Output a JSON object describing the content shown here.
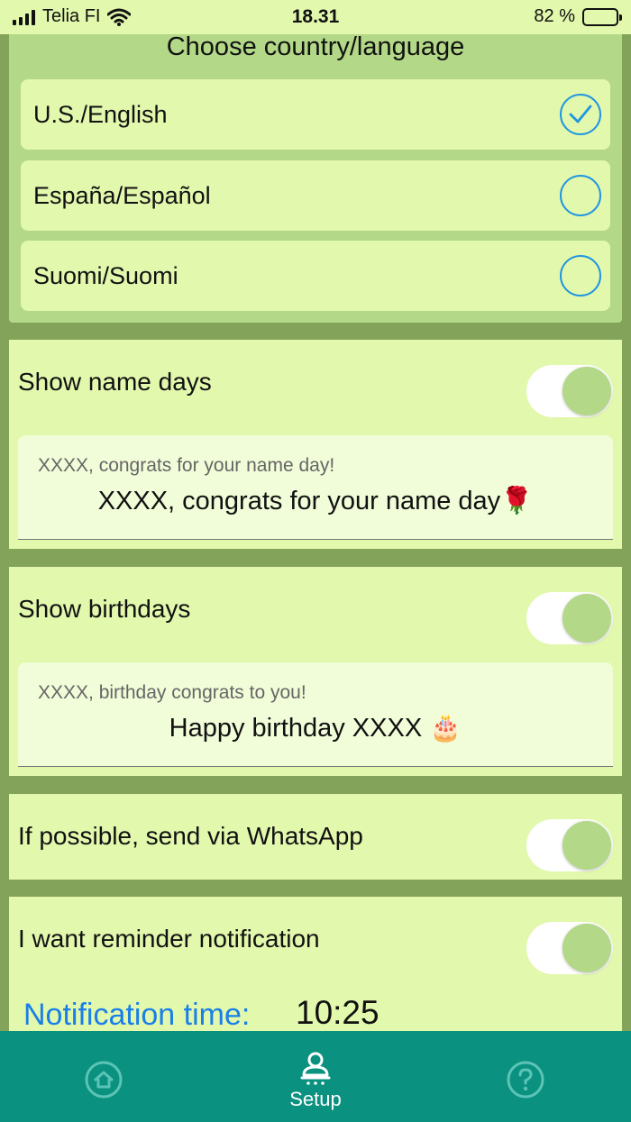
{
  "status_bar": {
    "carrier": "Telia FI",
    "time": "18.31",
    "battery_percent": "82 %",
    "battery_level": 0.82
  },
  "language_section": {
    "title": "Choose country/language",
    "options": [
      {
        "label": "U.S./English",
        "selected": true
      },
      {
        "label": "España/Español",
        "selected": false
      },
      {
        "label": "Suomi/Suomi",
        "selected": false
      }
    ]
  },
  "name_days": {
    "label": "Show name days",
    "toggle_on": true,
    "placeholder": "XXXX, congrats for your name day!",
    "message": "XXXX, congrats for your name day🌹"
  },
  "birthdays": {
    "label": "Show birthdays",
    "toggle_on": true,
    "placeholder": "XXXX, birthday congrats to you!",
    "message": "Happy birthday XXXX 🎂"
  },
  "whatsapp": {
    "label": "If possible, send via WhatsApp",
    "toggle_on": true
  },
  "reminder": {
    "label": "I want reminder notification",
    "toggle_on": true,
    "time_label": "Notification time:",
    "time_value": "10:25"
  },
  "tab_bar": {
    "tabs": [
      {
        "icon": "home-icon",
        "label": "",
        "active": false
      },
      {
        "icon": "setup-person-icon",
        "label": "Setup",
        "active": true
      },
      {
        "icon": "help-icon",
        "label": "",
        "active": false
      }
    ]
  },
  "colors": {
    "page_background": "#83a35a",
    "card_background": "#e2f8ad",
    "panel_background": "#b3d887",
    "accent_blue": "#2196e0",
    "link_blue": "#1a7fe8",
    "tab_bar": "#0a9180"
  }
}
